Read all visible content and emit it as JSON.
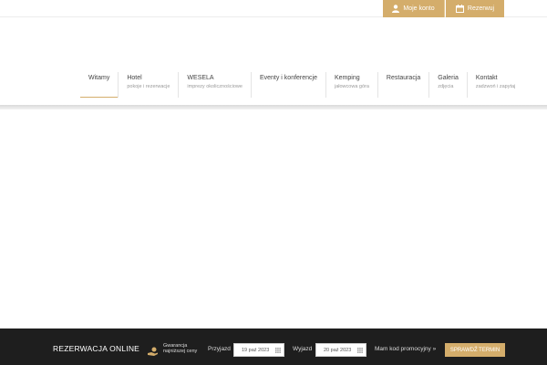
{
  "topbar": {
    "account_label": "Moje konto",
    "reserve_label": "Rezerwuj",
    "accent": "#d4ad6b"
  },
  "nav": [
    {
      "label": "Witamy",
      "sub": ""
    },
    {
      "label": "Hotel",
      "sub": "pokoje i rezerwacje"
    },
    {
      "label": "WESELA",
      "sub": "imprezy okolicznościowe"
    },
    {
      "label": "Eventy i konferencje",
      "sub": ""
    },
    {
      "label": "Kemping",
      "sub": "jałowcowa góra"
    },
    {
      "label": "Restauracja",
      "sub": ""
    },
    {
      "label": "Galeria",
      "sub": "zdjęcia"
    },
    {
      "label": "Kontakt",
      "sub": "zadzwoń i zapytaj"
    }
  ],
  "booking": {
    "title": "REZERWACJA ONLINE",
    "guarantee": "Gwarancja najniższej ceny",
    "arrival_label": "Przyjazd",
    "arrival_value": "19 paź 2023",
    "departure_label": "Wyjazd",
    "departure_value": "20 paź 2023",
    "promo_label": "Mam kod promocyjny »",
    "submit_label": "SPRAWDŹ TERMIN"
  },
  "icons": {
    "account": "user-icon",
    "reserve": "calendar-icon",
    "guarantee": "hand-coin-icon",
    "date": "calendar-grid-icon"
  }
}
